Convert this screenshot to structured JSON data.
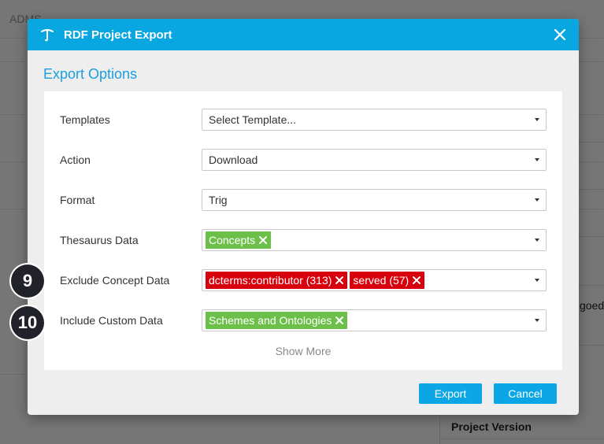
{
  "background": {
    "tab_label": "ADMS",
    "partial_text": "goed-",
    "project_version_label": "Project Version"
  },
  "modal": {
    "title": "RDF Project Export",
    "section_title": "Export Options",
    "rows": [
      {
        "label": "Templates",
        "value": "Select Template..."
      },
      {
        "label": "Action",
        "value": "Download"
      },
      {
        "label": "Format",
        "value": "Trig"
      },
      {
        "label": "Thesaurus Data",
        "tags": [
          {
            "text": "Concepts",
            "color": "#6cc04a"
          }
        ]
      },
      {
        "label": "Exclude Concept Data",
        "tags": [
          {
            "text": "dcterms:contributor (313)",
            "color": "#d8000c"
          },
          {
            "text": "served (57)",
            "color": "#d8000c"
          }
        ]
      },
      {
        "label": "Include Custom Data",
        "tags": [
          {
            "text": "Schemes and Ontologies",
            "color": "#6cc04a"
          }
        ]
      }
    ],
    "show_more": "Show More",
    "export_label": "Export",
    "cancel_label": "Cancel"
  },
  "badges": [
    "9",
    "10"
  ],
  "colors": {
    "header": "#08a7e2",
    "accent": "#1a9fe0",
    "button": "#0ba6e5"
  }
}
